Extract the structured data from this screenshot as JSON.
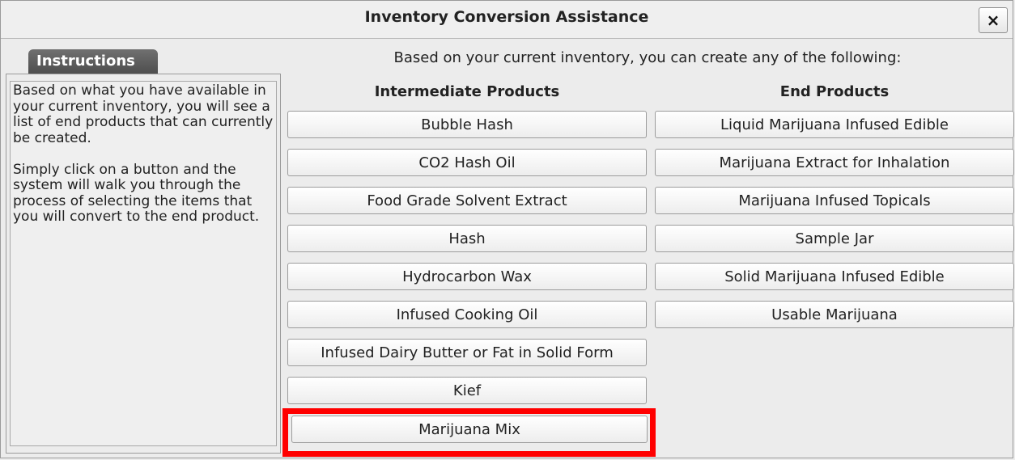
{
  "window": {
    "title": "Inventory Conversion Assistance",
    "close_label": "×"
  },
  "instructions": {
    "tab_label": "Instructions",
    "paragraph1": "Based on what you have available in your current inventory, you will see a list of end products that can currently be created.",
    "paragraph2": "Simply click on a button and the system will walk you through the process of selecting the items that you will convert to the end product."
  },
  "main": {
    "intro": "Based on your current inventory, you can create any of the following:",
    "intermediate_header": "Intermediate Products",
    "end_header": "End Products",
    "intermediate_products": [
      "Bubble Hash",
      "CO2 Hash Oil",
      "Food Grade Solvent Extract",
      "Hash",
      "Hydrocarbon Wax",
      "Infused Cooking Oil",
      "Infused Dairy Butter or Fat in Solid Form",
      "Kief",
      "Marijuana Mix"
    ],
    "end_products": [
      "Liquid Marijuana Infused Edible",
      "Marijuana Extract for Inhalation",
      "Marijuana Infused Topicals",
      "Sample Jar",
      "Solid Marijuana Infused Edible",
      "Usable Marijuana"
    ]
  },
  "colors": {
    "highlight": "#ff0000",
    "tab_bg": "#5a5a5a"
  }
}
